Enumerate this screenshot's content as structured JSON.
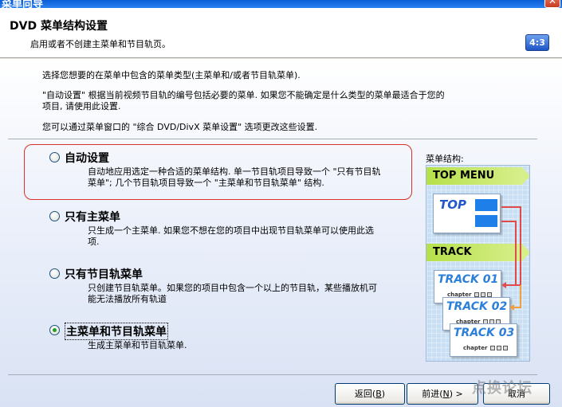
{
  "window": {
    "title": "菜单向导",
    "close_glyph": "✕"
  },
  "header": {
    "title": "DVD 菜单结构设置",
    "subtitle": "启用或者不创建主菜单和节目轨页。",
    "ratio_badge": "4:3"
  },
  "intro": {
    "line1": "选择您想要的在菜单中包含的菜单类型(主菜单和/或者节目轨菜单).",
    "line2a": "\"自动设置\" 根据当前视频节目轨的编号包括必要的菜单. 如果您不能确定是什么类型的菜单最适合于您的",
    "line2b": "项目, 请使用此设置.",
    "line3": "您可以通过菜单窗口的 \"综合 DVD/DivX 菜单设置\" 选项更改这些设置."
  },
  "options": [
    {
      "label": "自动设置",
      "desc1": "自动地应用选定一种合适的菜单结构. 单一节目轨项目导致一个 \"只有节目轨",
      "desc2": "菜单\"; 几个节目轨项目导致一个 \"主菜单和节目轨菜单\" 结构.",
      "checked": false
    },
    {
      "label": "只有主菜单",
      "desc1": "只生成一个主菜单. 如果您不想在您的项目中出现节目轨菜单可以使用此选",
      "desc2": "项.",
      "checked": false
    },
    {
      "label": "只有节目轨菜单",
      "desc1": "只创建节目轨菜单。如果您的项目中包含一个以上的节目轨，某些播放机可",
      "desc2": "能无法播放所有轨道",
      "checked": false
    },
    {
      "label": "主菜单和节目轨菜单",
      "desc1": "生成主菜单和节目轨菜单.",
      "desc2": "",
      "checked": true
    }
  ],
  "preview": {
    "label": "菜单结构:",
    "top_menu": "TOP MENU",
    "top_card": "TOP",
    "track_band": "TRACK",
    "tracks": [
      "TRACK 01",
      "TRACK 02",
      "TRACK 03"
    ],
    "chapter": "chapter",
    "colors": {
      "band": "#b6e04a",
      "blue": "#1f7fe8",
      "arrow_red": "#e04a4a",
      "arrow_orange": "#f0a040"
    }
  },
  "buttons": {
    "back": "返回",
    "back_key": "B",
    "next": "前进",
    "next_key": "N",
    "next_arrow": ">",
    "cancel": "取消"
  },
  "watermark": "点换论坛"
}
